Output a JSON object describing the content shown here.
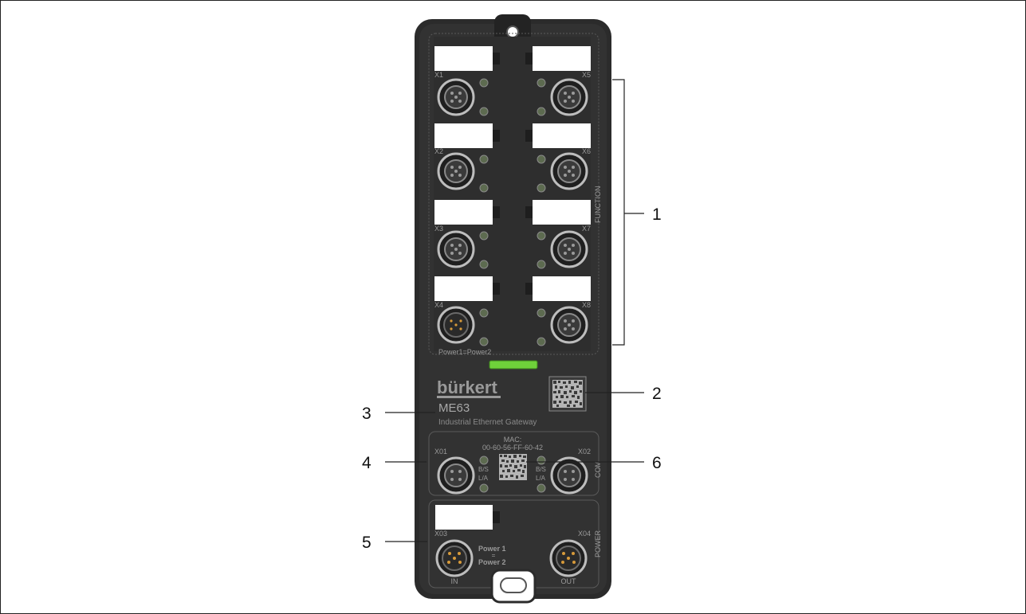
{
  "device": {
    "brand": "bürkert",
    "model": "ME63",
    "description": "Industrial Ethernet Gateway",
    "mac_label": "MAC:",
    "mac_value": "00-60-56-FF-60-42",
    "power_equal_label": "Power1=Power2",
    "function_label": "FUNCTION",
    "com_label": "COM",
    "power_label": "POWER",
    "in_label": "IN",
    "out_label": "OUT",
    "power_in_line1": "Power 1",
    "power_in_eq": "=",
    "power_in_line2": "Power 2"
  },
  "ports": {
    "x1": "X1",
    "x2": "X2",
    "x3": "X3",
    "x4": "X4",
    "x5": "X5",
    "x6": "X6",
    "x7": "X7",
    "x8": "X8",
    "x01": "X01",
    "x02": "X02",
    "x03": "X03",
    "x04": "X04"
  },
  "leds": {
    "bs": "B/S",
    "la": "L/A"
  },
  "callouts": [
    "1",
    "2",
    "3",
    "4",
    "5",
    "6"
  ],
  "colors": {
    "housing": "#2c2c2c",
    "panel": "#333333",
    "label_text": "#a8a8a8",
    "status_led_green": "#6fd13a",
    "side_strip_blue": "#6f93c7",
    "power_pin": "#d79a3a"
  }
}
